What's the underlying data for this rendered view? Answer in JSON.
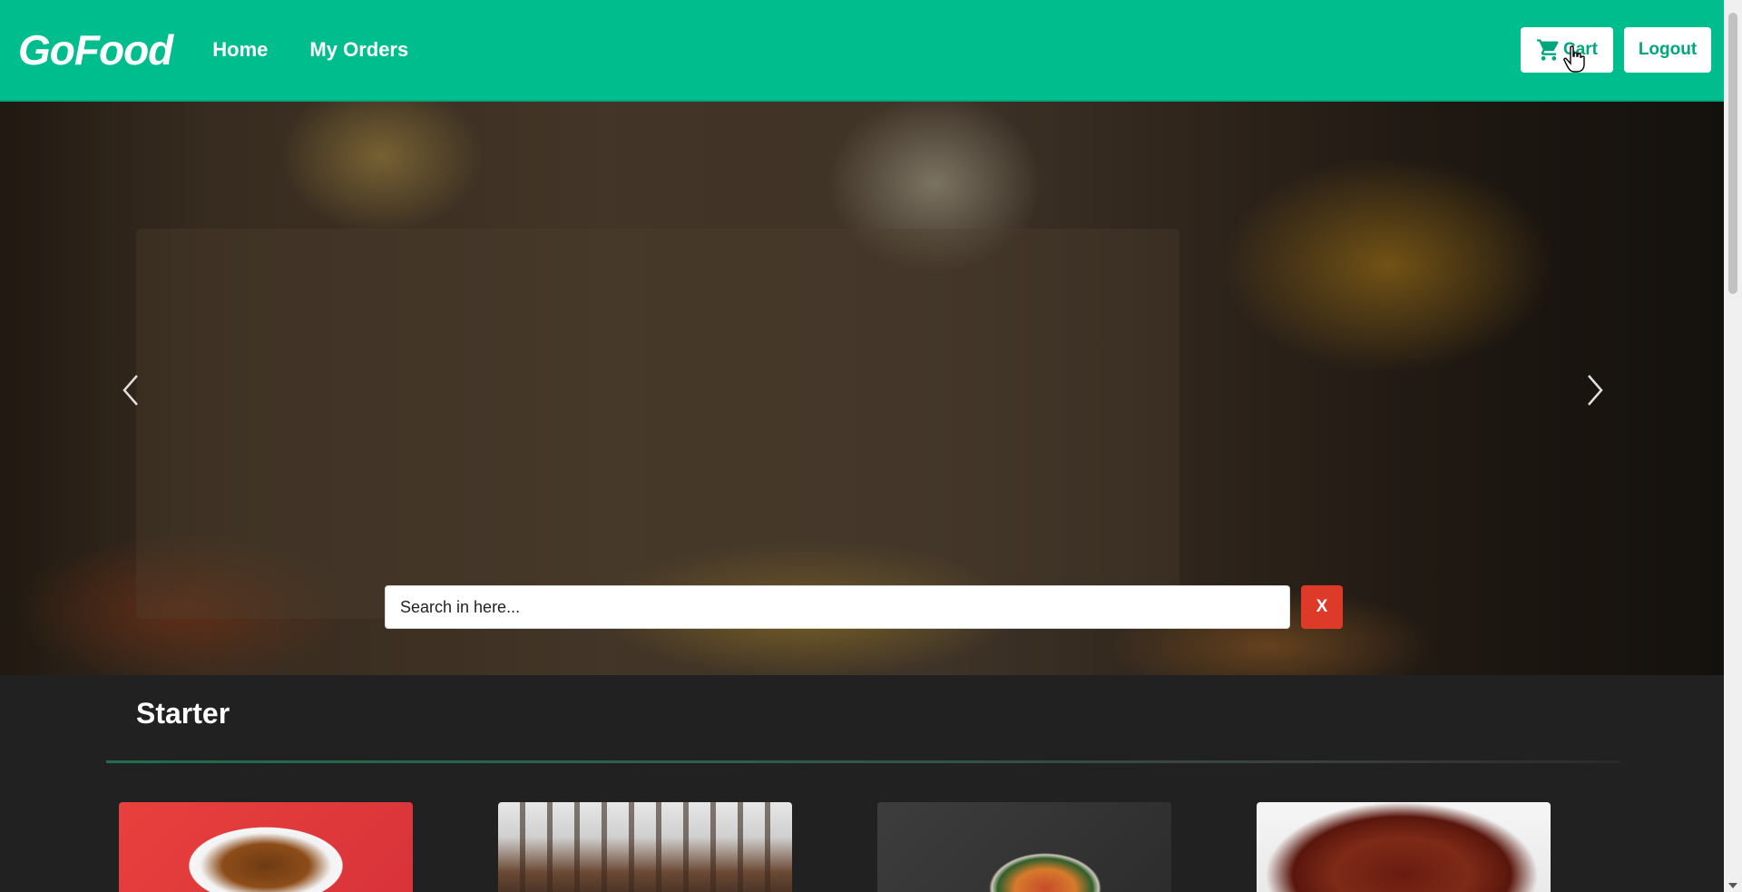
{
  "navbar": {
    "brand": "GoFood",
    "links": [
      {
        "label": "Home"
      },
      {
        "label": "My Orders"
      }
    ],
    "cart_label": "Cart",
    "cart_icon": "cart-icon",
    "logout_label": "Logout",
    "accent_color": "#00bd8e"
  },
  "hero": {
    "prev_icon": "chevron-left-icon",
    "next_icon": "chevron-right-icon",
    "search": {
      "placeholder": "Search in here...",
      "value": ""
    },
    "clear_label": "X",
    "clear_color": "#dd3a2a"
  },
  "categories": [
    {
      "title": "Starter",
      "cards": [
        {
          "name": "starter-card-1"
        },
        {
          "name": "starter-card-2"
        },
        {
          "name": "starter-card-3"
        },
        {
          "name": "starter-card-4"
        }
      ]
    }
  ],
  "pointer_icon": "hand-pointer-icon"
}
